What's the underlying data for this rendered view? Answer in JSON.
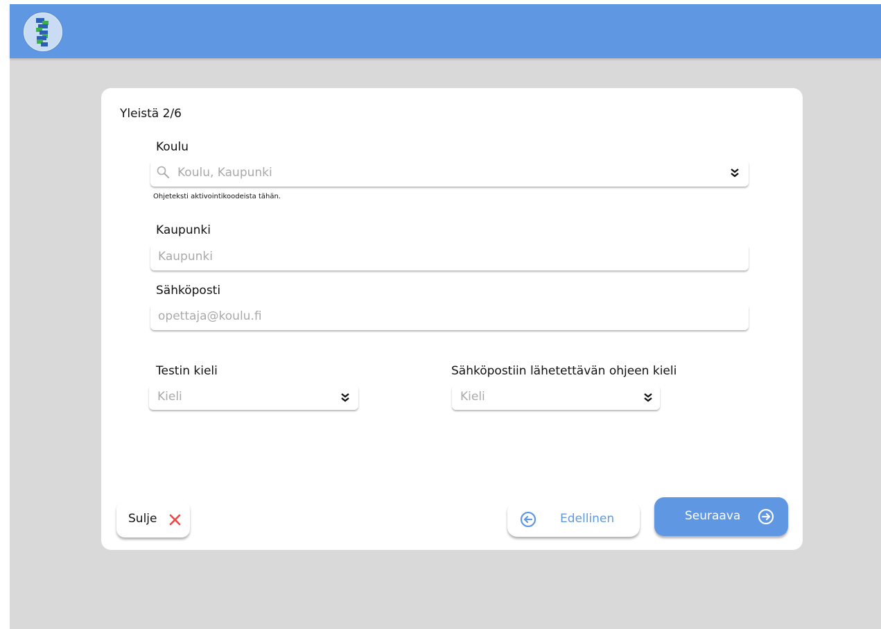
{
  "header": {
    "logo_icon": "dna-helix-logo-icon",
    "accent_color": "#5f97e3"
  },
  "wizard": {
    "step_title": "Yleistä 2/6",
    "school": {
      "label": "Koulu",
      "placeholder": "Koulu, Kaupunki",
      "help_text": "Ohjeteksti aktivointikoodeista tähän."
    },
    "city": {
      "label": "Kaupunki",
      "placeholder": "Kaupunki"
    },
    "email": {
      "label": "Sähköposti",
      "placeholder": "opettaja@koulu.fi"
    },
    "test_language": {
      "label": "Testin kieli",
      "placeholder": "Kieli"
    },
    "email_language": {
      "label": "Sähköpostiin lähetettävän ohjeen kieli",
      "placeholder": "Kieli"
    }
  },
  "buttons": {
    "close": "Sulje",
    "previous": "Edellinen",
    "next": "Seuraava"
  },
  "colors": {
    "primary": "#5f97e3",
    "close_icon": "#e64b4b",
    "background": "#d9d9d9"
  }
}
